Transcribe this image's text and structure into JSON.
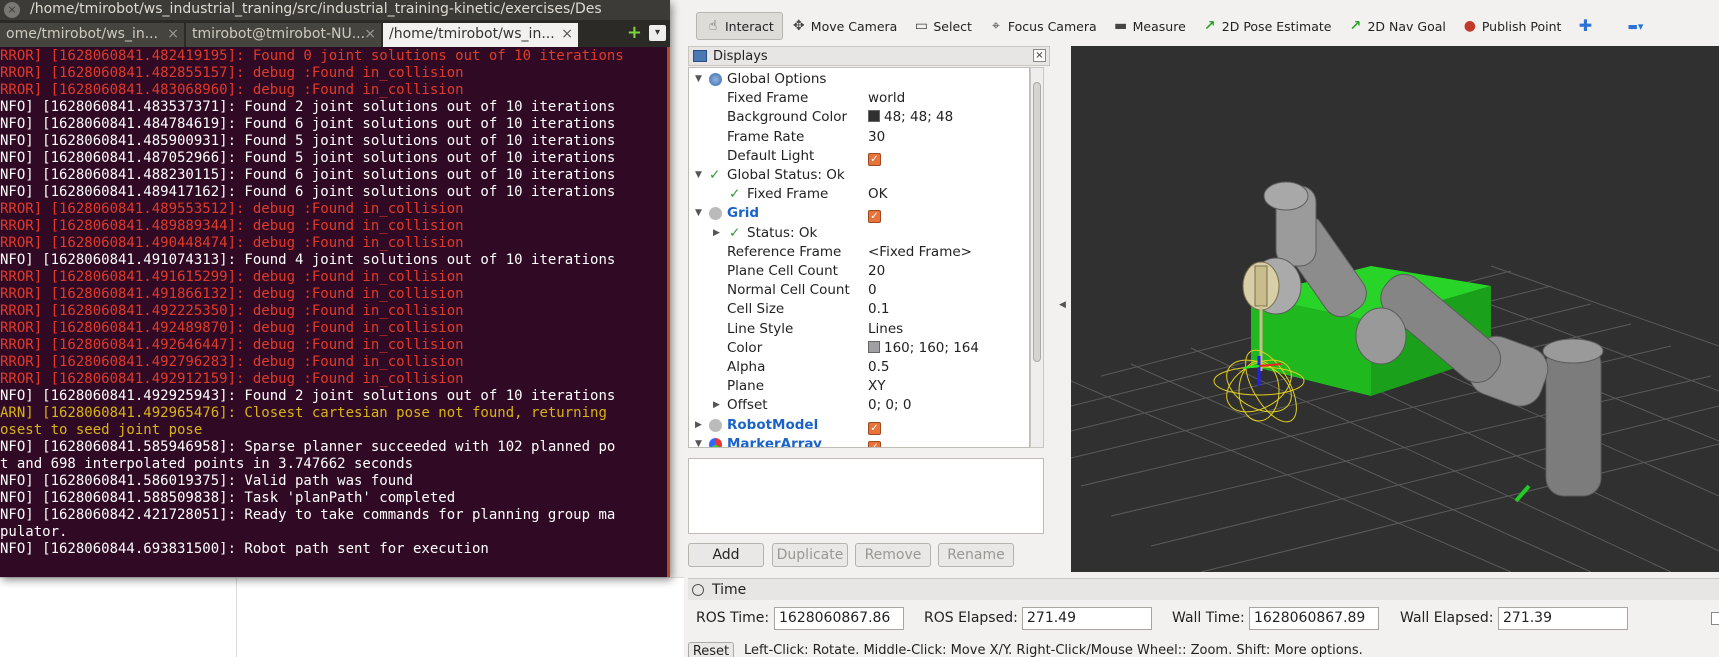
{
  "terminal": {
    "title": "/home/tmirobot/ws_industrial_traning/src/industrial_training-kinetic/exercises/Des",
    "close": "×",
    "tabs": [
      {
        "label": "ome/tmirobot/ws_in...",
        "active": false
      },
      {
        "label": "tmirobot@tmirobot-NU...",
        "active": false
      },
      {
        "label": "/home/tmirobot/ws_in...",
        "active": true
      }
    ],
    "tab_close": "×",
    "new_tab": "+",
    "menu": "▾",
    "lines": [
      {
        "level": "err",
        "text": "RROR] [1628060841.482419195]: Found 0 joint solutions out of 10 iterations"
      },
      {
        "level": "err",
        "text": "RROR] [1628060841.482855157]: debug :Found in_collision"
      },
      {
        "level": "err",
        "text": "RROR] [1628060841.483068960]: debug :Found in_collision"
      },
      {
        "level": "info",
        "text": "NFO] [1628060841.483537371]: Found 2 joint solutions out of 10 iterations"
      },
      {
        "level": "info",
        "text": "NFO] [1628060841.484784619]: Found 6 joint solutions out of 10 iterations"
      },
      {
        "level": "info",
        "text": "NFO] [1628060841.485900931]: Found 5 joint solutions out of 10 iterations"
      },
      {
        "level": "info",
        "text": "NFO] [1628060841.487052966]: Found 5 joint solutions out of 10 iterations"
      },
      {
        "level": "info",
        "text": "NFO] [1628060841.488230115]: Found 6 joint solutions out of 10 iterations"
      },
      {
        "level": "info",
        "text": "NFO] [1628060841.489417162]: Found 6 joint solutions out of 10 iterations"
      },
      {
        "level": "err",
        "text": "RROR] [1628060841.489553512]: debug :Found in_collision"
      },
      {
        "level": "err",
        "text": "RROR] [1628060841.489889344]: debug :Found in_collision"
      },
      {
        "level": "err",
        "text": "RROR] [1628060841.490448474]: debug :Found in_collision"
      },
      {
        "level": "info",
        "text": "NFO] [1628060841.491074313]: Found 4 joint solutions out of 10 iterations"
      },
      {
        "level": "err",
        "text": "RROR] [1628060841.491615299]: debug :Found in_collision"
      },
      {
        "level": "err",
        "text": "RROR] [1628060841.491866132]: debug :Found in_collision"
      },
      {
        "level": "err",
        "text": "RROR] [1628060841.492225350]: debug :Found in_collision"
      },
      {
        "level": "err",
        "text": "RROR] [1628060841.492489870]: debug :Found in_collision"
      },
      {
        "level": "err",
        "text": "RROR] [1628060841.492646447]: debug :Found in_collision"
      },
      {
        "level": "err",
        "text": "RROR] [1628060841.492796283]: debug :Found in_collision"
      },
      {
        "level": "err",
        "text": "RROR] [1628060841.492912159]: debug :Found in_collision"
      },
      {
        "level": "info",
        "text": "NFO] [1628060841.492925943]: Found 2 joint solutions out of 10 iterations"
      },
      {
        "level": "warn",
        "text": "ARN] [1628060841.492965476]: Closest cartesian pose not found, returning"
      },
      {
        "level": "warn",
        "text": "osest to seed joint pose"
      },
      {
        "level": "info",
        "text": "NFO] [1628060841.585946958]: Sparse planner succeeded with 102 planned po"
      },
      {
        "level": "info",
        "text": "t and 698 interpolated points in 3.747662 seconds"
      },
      {
        "level": "info",
        "text": "NFO] [1628060841.586019375]: Valid path was found"
      },
      {
        "level": "info",
        "text": "NFO] [1628060841.588509838]: Task 'planPath' completed"
      },
      {
        "level": "info",
        "text": "NFO] [1628060842.421728051]: Ready to take commands for planning group ma"
      },
      {
        "level": "info",
        "text": "pulator."
      },
      {
        "level": "info",
        "text": "NFO] [1628060844.693831500]: Robot path sent for execution"
      }
    ]
  },
  "toolbar": {
    "tools": [
      {
        "label": "Interact",
        "icon": "hand-icon",
        "glyph": "☝",
        "active": true
      },
      {
        "label": "Move Camera",
        "icon": "move-camera-icon",
        "glyph": "✥",
        "active": false
      },
      {
        "label": "Select",
        "icon": "select-icon",
        "glyph": "▭",
        "active": false
      },
      {
        "label": "Focus Camera",
        "icon": "focus-camera-icon",
        "glyph": "⌖",
        "active": false
      },
      {
        "label": "Measure",
        "icon": "measure-icon",
        "glyph": "▬",
        "active": false
      },
      {
        "label": "2D Pose Estimate",
        "icon": "pose-estimate-icon",
        "glyph": "↗",
        "active": false
      },
      {
        "label": "2D Nav Goal",
        "icon": "nav-goal-icon",
        "glyph": "↗",
        "active": false
      },
      {
        "label": "Publish Point",
        "icon": "map-pin-icon",
        "glyph": "●",
        "active": false
      }
    ],
    "add_glyph": "✚",
    "minus_glyph": "▬▾"
  },
  "displays": {
    "title": "Displays",
    "close": "×",
    "rows": [
      {
        "name": "Global Options",
        "value": "",
        "arrow": "▼",
        "kind": "global"
      },
      {
        "name": "Fixed Frame",
        "value": "world"
      },
      {
        "name": "Background Color",
        "value": "48; 48; 48",
        "swatch": "#303030"
      },
      {
        "name": "Frame Rate",
        "value": "30"
      },
      {
        "name": "Default Light",
        "value": "",
        "checkbox": true
      },
      {
        "name": "Global Status: Ok",
        "value": "",
        "arrow": "▼",
        "kind": "status"
      },
      {
        "name": "Fixed Frame",
        "value": "OK",
        "kind": "substatus"
      },
      {
        "name": "Grid",
        "value": "",
        "arrow": "▼",
        "kind": "display",
        "checkbox": true
      },
      {
        "name": "Status: Ok",
        "value": "",
        "arrow": "▶",
        "kind": "status2"
      },
      {
        "name": "Reference Frame",
        "value": "<Fixed Frame>"
      },
      {
        "name": "Plane Cell Count",
        "value": "20"
      },
      {
        "name": "Normal Cell Count",
        "value": "0"
      },
      {
        "name": "Cell Size",
        "value": "0.1"
      },
      {
        "name": "Line Style",
        "value": "Lines"
      },
      {
        "name": "Color",
        "value": "160; 160; 164",
        "swatch": "#a0a0a4"
      },
      {
        "name": "Alpha",
        "value": "0.5"
      },
      {
        "name": "Plane",
        "value": "XY"
      },
      {
        "name": "Offset",
        "value": "0; 0; 0",
        "arrow": "▶",
        "kind": "sub"
      },
      {
        "name": "RobotModel",
        "value": "",
        "arrow": "▶",
        "kind": "display",
        "checkbox": true
      },
      {
        "name": "MarkerArray",
        "value": "",
        "arrow": "▼",
        "kind": "display",
        "checkbox": true
      }
    ],
    "check_glyph": "✓",
    "buttons": {
      "add": "Add",
      "duplicate": "Duplicate",
      "remove": "Remove",
      "rename": "Rename"
    }
  },
  "time": {
    "title": "Time",
    "ros_time_label": "ROS Time:",
    "ros_time": "1628060867.86",
    "ros_elapsed_label": "ROS Elapsed:",
    "ros_elapsed": "271.49",
    "wall_time_label": "Wall Time:",
    "wall_time": "1628060867.89",
    "wall_elapsed_label": "Wall Elapsed:",
    "wall_elapsed": "271.39"
  },
  "statusbar": {
    "reset": "Reset",
    "help": "Left-Click: Rotate. Middle-Click: Move X/Y. Right-Click/Mouse Wheel:: Zoom. Shift: More options."
  },
  "colors": {
    "terminal_bg": "#300a24",
    "error": "#e03a2a",
    "warn": "#d7b415",
    "view_bg": "#303030",
    "box_green": "#22cc22",
    "display_blue": "#1a63c9"
  }
}
